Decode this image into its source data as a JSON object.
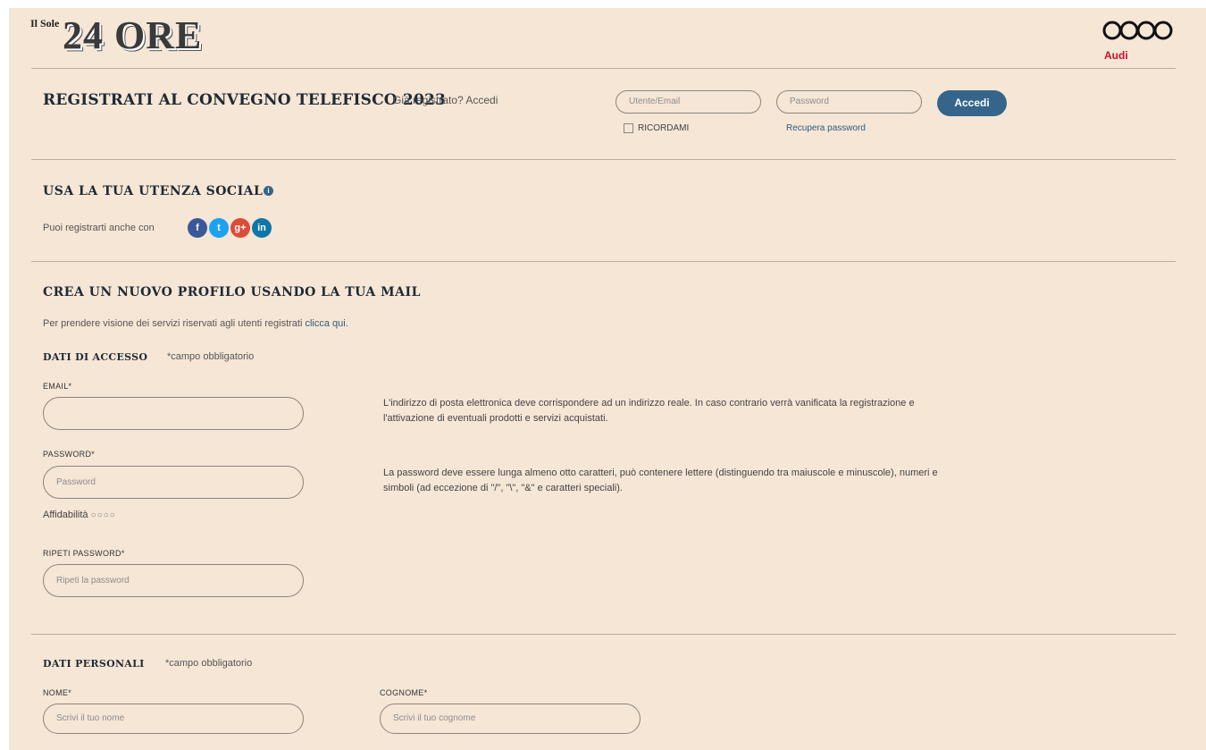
{
  "header": {
    "brand_small": "Il Sole",
    "brand_big": "24 ORE",
    "sponsor": "Audi"
  },
  "login": {
    "title": "REGISTRATI AL CONVEGNO TELEFISCO 2023",
    "already_registered": "Già registrato? Accedi",
    "user_placeholder": "Utente/Email",
    "password_placeholder": "Password",
    "submit_label": "Accedi",
    "remember_label": "RICORDAMI",
    "recover_label": "Recupera password"
  },
  "social": {
    "title": "USA LA TUA UTENZA SOCIAL",
    "info_glyph": "i",
    "text": "Puoi registrarti anche con",
    "networks": [
      {
        "name": "facebook-icon",
        "glyph": "f",
        "color": "#3b5998"
      },
      {
        "name": "twitter-icon",
        "glyph": "t",
        "color": "#1da1f2"
      },
      {
        "name": "google-plus-icon",
        "glyph": "g+",
        "color": "#dd4b39"
      },
      {
        "name": "linkedin-icon",
        "glyph": "in",
        "color": "#0e76a8"
      }
    ]
  },
  "new_profile": {
    "title": "CREA UN NUOVO PROFILO USANDO LA TUA MAIL",
    "intro": "Per prendere visione dei servizi riservati agli utenti registrati",
    "intro_link": "clicca qui."
  },
  "access": {
    "title": "DATI DI ACCESSO",
    "required_note": "*campo obbligatorio",
    "email_label": "EMAIL*",
    "email_help": "L'indirizzo di posta elettronica deve corrispondere ad un indirizzo reale. In caso contrario verrà vanificata la registrazione e l'attivazione di eventuali prodotti e servizi acquistati.",
    "password_label": "PASSWORD*",
    "password_placeholder": "Password",
    "password_help": "La password deve essere lunga almeno otto caratteri, può contenere lettere (distinguendo tra maiuscole e minuscole), numeri e simboli (ad eccezione di \"/\", \"\\\", \"&\" e caratteri speciali).",
    "strength_label": "Affidabilità",
    "strength_level": 0,
    "repeat_label": "RIPETI PASSWORD*",
    "repeat_placeholder": "Ripeti la password"
  },
  "personal": {
    "title": "DATI PERSONALI",
    "required_note": "*campo obbligatorio",
    "name_label": "NOME*",
    "name_placeholder": "Scrivi il tuo nome",
    "surname_label": "COGNOME*",
    "surname_placeholder": "Scrivi il tuo cognome"
  }
}
